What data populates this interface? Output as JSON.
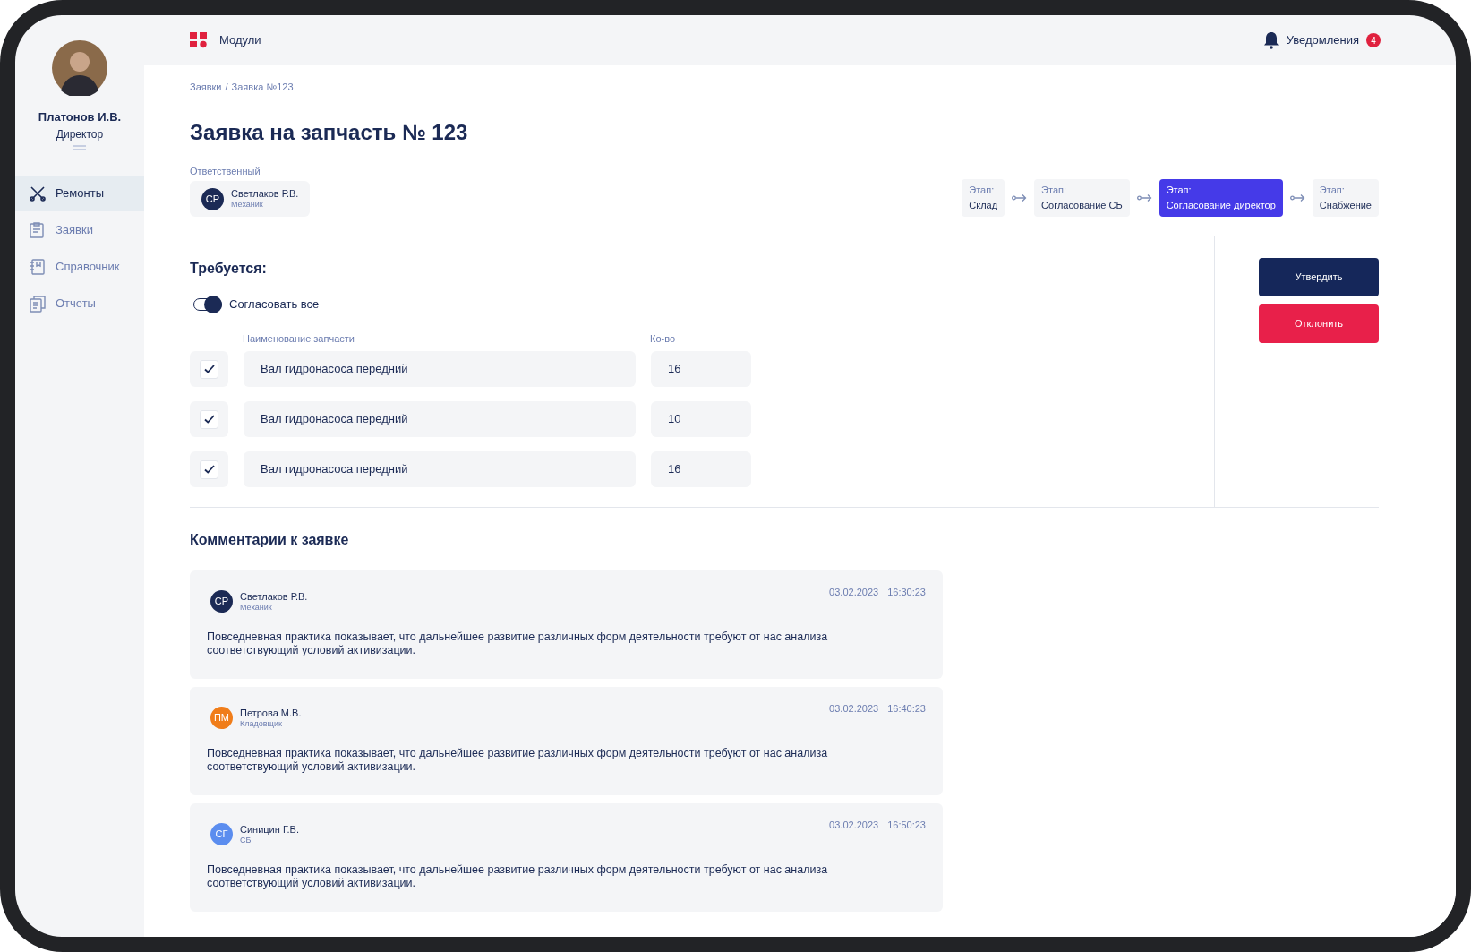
{
  "user": {
    "name": "Платонов И.В.",
    "role": "Директор"
  },
  "nav": [
    {
      "label": "Ремонты",
      "selected": true
    },
    {
      "label": "Заявки",
      "selected": false
    },
    {
      "label": "Справочник",
      "selected": false
    },
    {
      "label": "Отчеты",
      "selected": false
    }
  ],
  "topbar": {
    "modules": "Модули",
    "notifications": "Уведомления",
    "notification_count": "4"
  },
  "breadcrumbs": {
    "items": [
      "Заявки",
      "Заявка №123"
    ],
    "separator": "/"
  },
  "title": "Заявка на запчасть № 123",
  "responsible": {
    "label": "Ответственный",
    "initials": "СР",
    "name": "Светлаков Р.В.",
    "role": "Механик",
    "color": "#1b2a55"
  },
  "stages": [
    {
      "label": "Этап:",
      "name": "Склад",
      "selected": false
    },
    {
      "label": "Этап:",
      "name": "Согласование СБ",
      "selected": false
    },
    {
      "label": "Этап:",
      "name": "Согласование директор",
      "selected": true
    },
    {
      "label": "Этап:",
      "name": "Снабжение",
      "selected": false
    }
  ],
  "required": {
    "heading": "Требуется:",
    "toggle": {
      "label": "Согласовать все",
      "on": true
    },
    "columns": [
      "Наименование запчасти",
      "Ко-во"
    ],
    "rows": [
      {
        "checked": true,
        "name": "Вал гидронасоса передний",
        "qty": "16"
      },
      {
        "checked": true,
        "name": "Вал гидронасоса передний",
        "qty": "10"
      },
      {
        "checked": true,
        "name": "Вал гидронасоса передний",
        "qty": "16"
      }
    ]
  },
  "actions": [
    {
      "kind": "approve",
      "label": "Утвердить"
    },
    {
      "kind": "reject",
      "label": "Отклонить"
    }
  ],
  "comments": {
    "heading": "Комментарии к заявке",
    "items": [
      {
        "initials": "СР",
        "color": "#1b2a55",
        "name": "Светлаков Р.В.",
        "role": "Механик",
        "date": "03.02.2023",
        "time": "16:30:23",
        "text": "Повседневная практика показывает, что дальнейшее развитие различных форм деятельности требуют от нас анализа соответствующий условий активизации."
      },
      {
        "initials": "ПМ",
        "color": "#f07d1a",
        "name": "Петрова М.В.",
        "role": "Кладовщик",
        "date": "03.02.2023",
        "time": "16:40:23",
        "text": "Повседневная практика показывает, что дальнейшее развитие различных форм деятельности требуют от нас анализа соответствующий условий активизации."
      },
      {
        "initials": "СГ",
        "color": "#5b8def",
        "name": "Синицин Г.В.",
        "role": "СБ",
        "date": "03.02.2023",
        "time": "16:50:23",
        "text": "Повседневная практика показывает, что дальнейшее развитие различных форм деятельности требуют от нас анализа соответствующий условий активизации."
      }
    ]
  }
}
